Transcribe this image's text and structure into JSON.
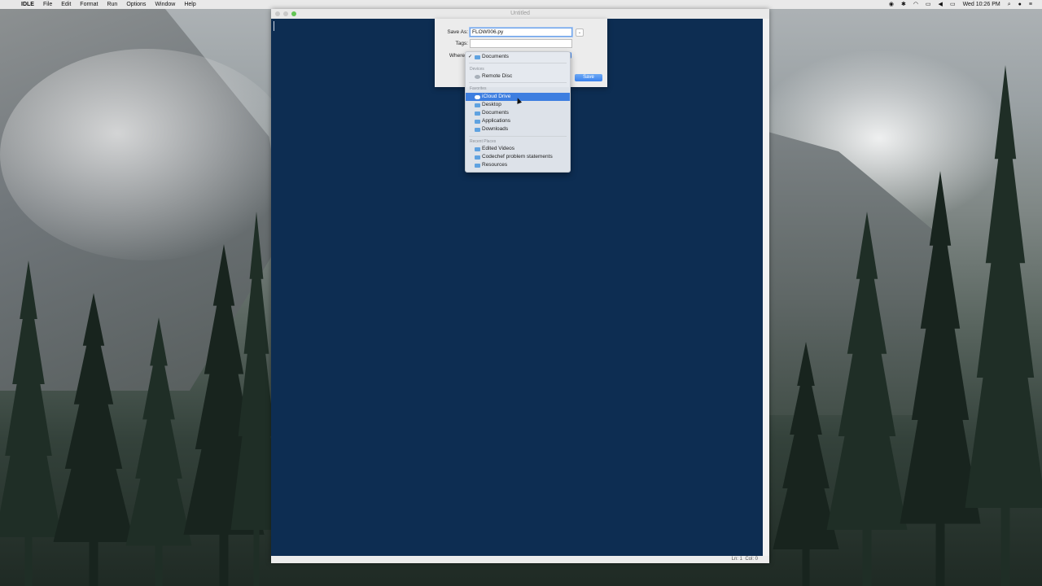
{
  "menubar": {
    "app_name": "IDLE",
    "menus": [
      "File",
      "Edit",
      "Format",
      "Run",
      "Options",
      "Window",
      "Help"
    ],
    "clock": "Wed 10:26 PM"
  },
  "window": {
    "title": "Untitled",
    "status_ln": "Ln: 1",
    "status_col": "Col: 0"
  },
  "save_dialog": {
    "save_as_label": "Save As:",
    "filename": "FLOW006.py",
    "tags_label": "Tags:",
    "where_label": "Where",
    "save_button": "Save"
  },
  "location_menu": {
    "current": "Documents",
    "devices_header": "Devices",
    "devices": [
      "Remote Disc"
    ],
    "favorites_header": "Favorites",
    "favorites": [
      "iCloud Drive",
      "Desktop",
      "Documents",
      "Applications",
      "Downloads"
    ],
    "selected": "iCloud Drive",
    "recent_header": "Recent Places",
    "recent": [
      "Edited Videos",
      "Codechef problem statements",
      "Resources"
    ]
  },
  "colors": {
    "editor_bg": "#0d2d52",
    "accent": "#3d7ee0"
  }
}
